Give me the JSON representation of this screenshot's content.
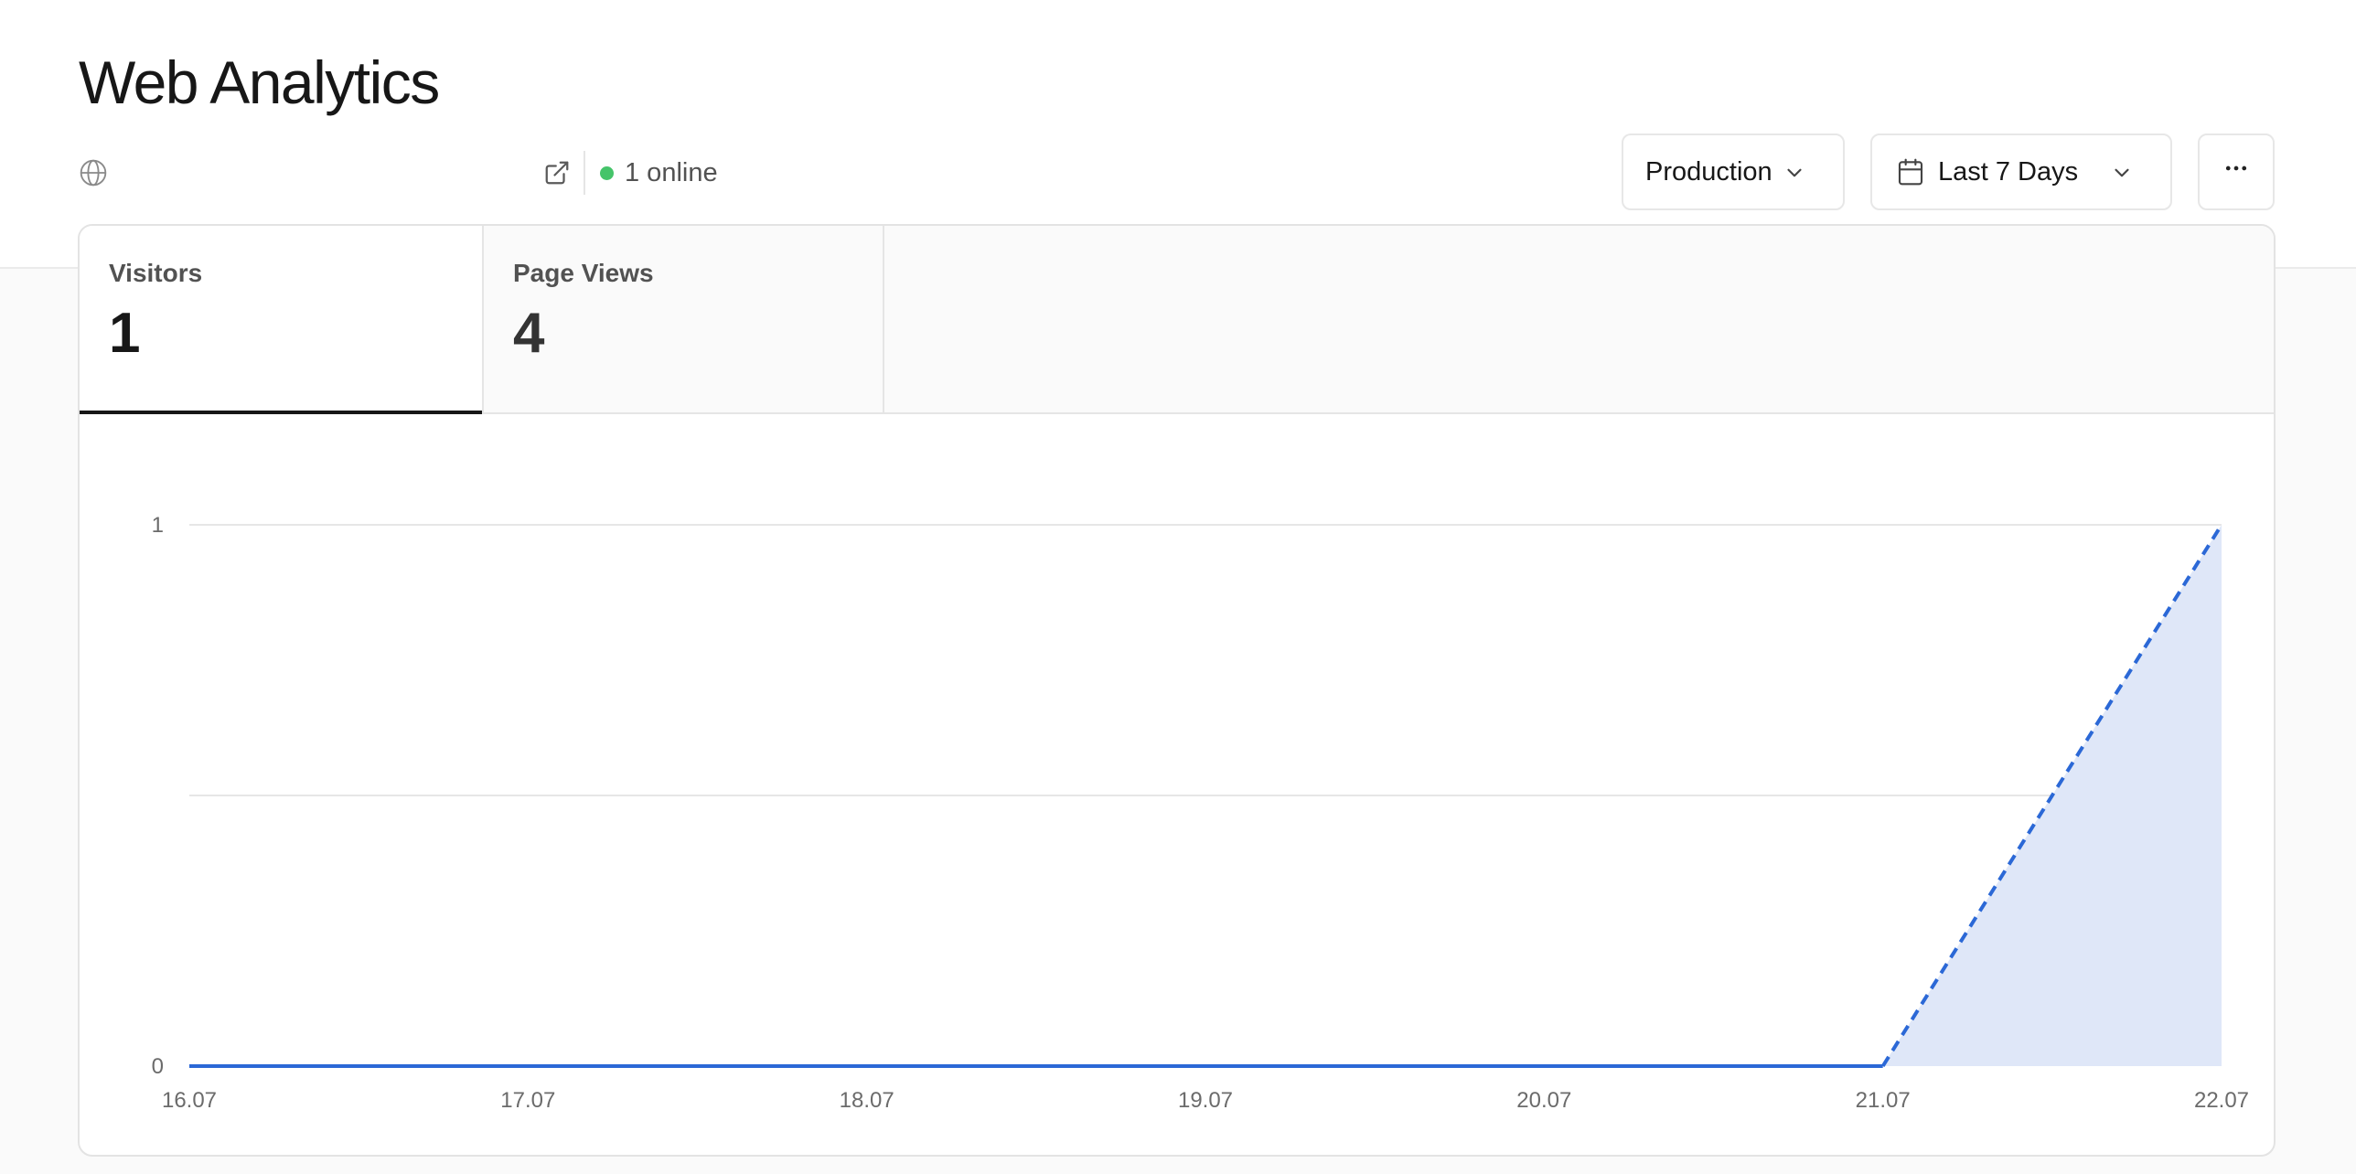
{
  "header": {
    "title": "Web Analytics",
    "site_domain": "",
    "online_text": "1 online"
  },
  "controls": {
    "environment": "Production",
    "date_range": "Last 7 Days",
    "more_label": "···"
  },
  "tabs": [
    {
      "label": "Visitors",
      "value": "1",
      "active": true
    },
    {
      "label": "Page Views",
      "value": "4",
      "active": false
    }
  ],
  "colors": {
    "accent_line": "#2b68d6",
    "accent_fill": "#dfe7f8",
    "online": "#45c46a",
    "grid": "#e6e6e6"
  },
  "icons": [
    "globe-icon",
    "external-link-icon",
    "chevron-down-icon",
    "calendar-icon",
    "more-icon"
  ],
  "chart_data": {
    "type": "area",
    "x": [
      "16.07",
      "17.07",
      "18.07",
      "19.07",
      "20.07",
      "21.07",
      "22.07"
    ],
    "values": [
      0,
      0,
      0,
      0,
      0,
      0,
      1
    ],
    "ylim": [
      0,
      1
    ],
    "yticks": [
      "0",
      "1"
    ],
    "partial_last_segment": true,
    "grid": true,
    "title": "",
    "xlabel": "",
    "ylabel": ""
  }
}
